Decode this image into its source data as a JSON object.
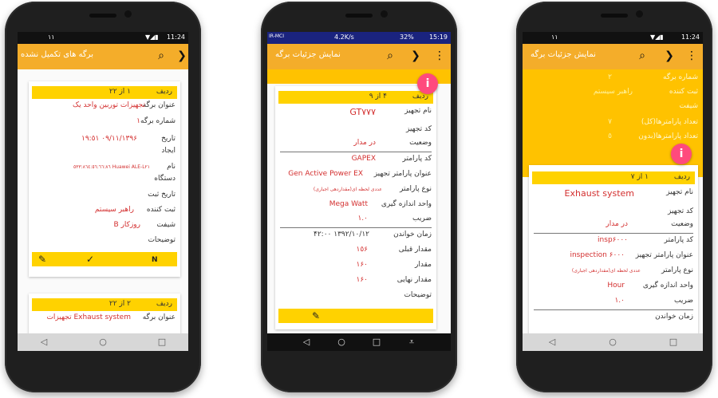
{
  "phone1": {
    "status": {
      "left": "١١",
      "time": "11:24"
    },
    "appbar": {
      "title": "برگه های تکمیل نشده"
    },
    "card1": {
      "header_label": "ردیف",
      "header_value": "١ از ٢٢",
      "rows": [
        {
          "k": "عنوان برگه",
          "v": "تجهیزات توربین واحد یک"
        },
        {
          "k": "شماره برگه",
          "v": "١"
        },
        {
          "k": "تاریخ",
          "v": "١٣٩۶/٠٩/١١ ١٩:٥١"
        },
        {
          "k": "ایجاد",
          "v": ""
        },
        {
          "k": "نام",
          "v": "Huawei ALE-L٢١ ٥٣٣:٨٦٤:٥٦:٦٦:٨٦"
        },
        {
          "k": "دستگاه",
          "v": ""
        },
        {
          "k": "تاریخ ثبت",
          "v": ""
        },
        {
          "k": "ثبت کننده",
          "v": "راهبر سیستم"
        },
        {
          "k": "شیفت",
          "v": "روزکار B"
        },
        {
          "k": "توضیحات",
          "v": ""
        }
      ]
    },
    "card2": {
      "header_label": "ردیف",
      "header_value": "٢ از ٢٢",
      "rows": [
        {
          "k": "عنوان برگه",
          "v": "Exhaust system تجهیزات"
        }
      ]
    }
  },
  "phone2": {
    "status": {
      "left": "IR-MCI",
      "speed": "4.2K/s",
      "battery": "32%",
      "time": "15:19"
    },
    "appbar": {
      "title": "نمایش جزئیات برگه"
    },
    "card": {
      "header_label": "ردیف",
      "header_value": "۴ از ٩",
      "rows": [
        {
          "k": "نام تجهیز",
          "v": "GT٧٧٧"
        },
        {
          "k": "کد تجهیز",
          "v": ""
        },
        {
          "k": "وضعیت",
          "v": "در مدار"
        },
        {
          "k": "کد پارامتر",
          "v": "GAPEX"
        },
        {
          "k": "عنوان پارامتر تجهیز",
          "v": "Gen Active Power EX"
        },
        {
          "k": "نوع پارامتر",
          "v": "عددی لحظه ای(مقداردهی اجباری)"
        },
        {
          "k": "واحد اندازه گیری",
          "v": "Mega Watt"
        },
        {
          "k": "ضریب",
          "v": "١.٠"
        },
        {
          "k": "زمان خواندن",
          "v": "١٣٩٢/١٠/١٢ ٠٠:۴٢"
        },
        {
          "k": "مقدار قبلی",
          "v": "١٥۶"
        },
        {
          "k": "مقدار",
          "v": "١۶٠"
        },
        {
          "k": "مقدار نهایی",
          "v": "١۶٠"
        },
        {
          "k": "توضیحات",
          "v": ""
        }
      ]
    }
  },
  "phone3": {
    "status": {
      "left": "١١",
      "time": "11:24"
    },
    "appbar": {
      "title": "نمایش جزئیات برگه"
    },
    "summary": [
      {
        "k": "شماره برگه",
        "v": "٢"
      },
      {
        "k": "ثبت کننده",
        "v": "راهبر سیستم"
      },
      {
        "k": "شیفت",
        "v": ""
      },
      {
        "k": "تعداد پارامترها(کل)",
        "v": "٧"
      },
      {
        "k": "تعداد پارامترها(بدون",
        "v": "٥"
      }
    ],
    "card": {
      "header_label": "ردیف",
      "header_value": "١ از ٧",
      "rows": [
        {
          "k": "نام تجهیز",
          "v": "Exhaust system"
        },
        {
          "k": "کد تجهیز",
          "v": ""
        },
        {
          "k": "وضعیت",
          "v": "در مدار"
        },
        {
          "k": "کد پارامتر",
          "v": "insp۶٠٠٠"
        },
        {
          "k": "عنوان پارامتر تجهیز",
          "v": "inspection ۶٠٠٠"
        },
        {
          "k": "نوع پارامتر",
          "v": "عددی لحظه ای(مقداردهی اجباری)"
        },
        {
          "k": "واحد اندازه گیری",
          "v": "Hour"
        },
        {
          "k": "ضریب",
          "v": "١.٠"
        },
        {
          "k": "زمان خواندن",
          "v": ""
        }
      ]
    }
  },
  "icons": {
    "search": "search-icon",
    "forward": "chevron-right-icon",
    "menu": "more-vert-icon",
    "info": "info-icon",
    "edit": "pencil-icon",
    "approve": "check-circle-icon",
    "nfc": "nfc-icon"
  },
  "colors": {
    "appbar": "#f4ad2a",
    "card_header": "#ffd200",
    "value_red": "#d32f2f",
    "fab": "#ff4a7d"
  }
}
